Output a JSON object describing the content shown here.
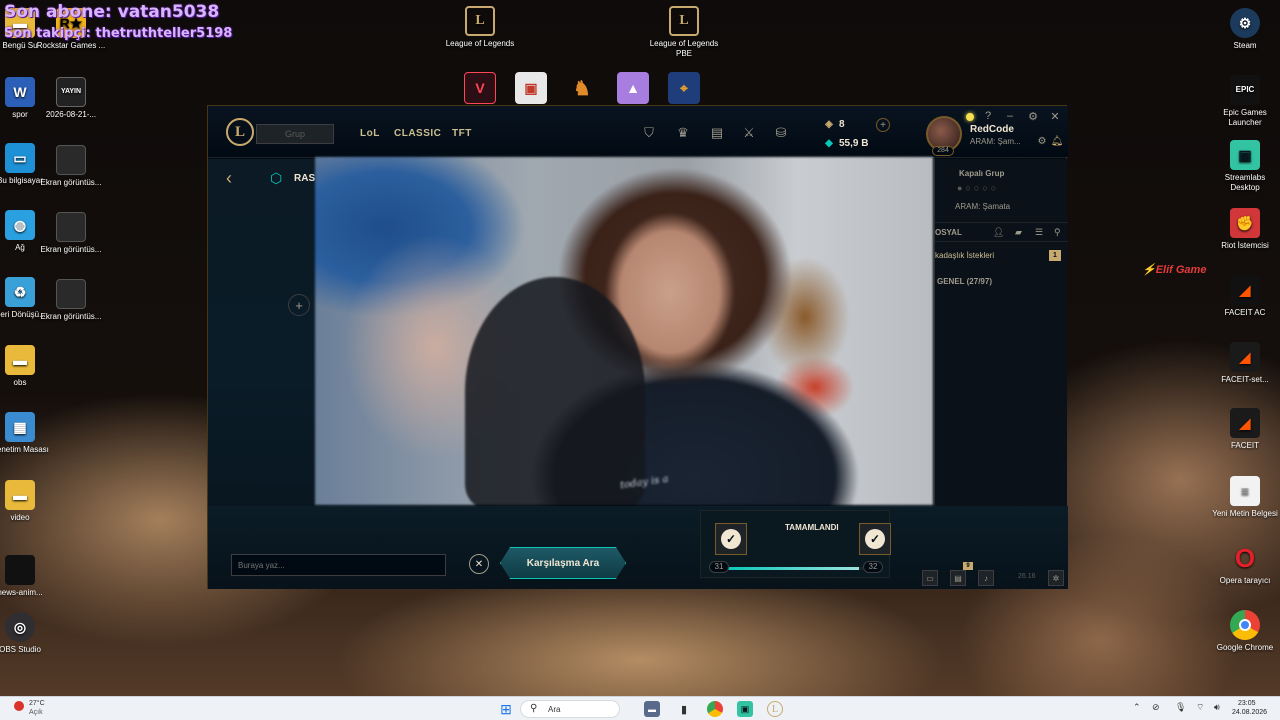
{
  "overlay": {
    "last_sub": "Son abone: vatan5038",
    "last_follow": "Son takipçi: thetruthteller5198"
  },
  "desktop_left": [
    {
      "label": "Bengü Su",
      "icon": "folder-icon",
      "color": "#e8b93a"
    },
    {
      "label": "Rockstar Games ...",
      "icon": "rockstar-icon",
      "color": "#f2b21a"
    },
    {
      "label": "spor",
      "icon": "word-doc-icon",
      "color": "#2b5fb8"
    },
    {
      "label": "2026-08-21-...",
      "icon": "image-file-icon",
      "color": "#222222"
    },
    {
      "label": "Bu bilgisayar",
      "icon": "computer-icon",
      "color": "#1e90d6"
    },
    {
      "label": "Ekran görüntüs...",
      "icon": "screenshot-icon",
      "color": "#2a2a2a"
    },
    {
      "label": "Ağ",
      "icon": "network-icon",
      "color": "#2aa0e0"
    },
    {
      "label": "Ekran görüntüs...",
      "icon": "screenshot-icon",
      "color": "#2a2a2a"
    },
    {
      "label": "Geri Dönüşü...",
      "icon": "recycle-bin-icon",
      "color": "#3aa0d8"
    },
    {
      "label": "Ekran görüntüs...",
      "icon": "screenshot-icon",
      "color": "#2a2a2a"
    },
    {
      "label": "obs",
      "icon": "folder-icon",
      "color": "#e8b93a"
    },
    {
      "label": "Denetim Masası",
      "icon": "control-panel-icon",
      "color": "#3a8bd0"
    },
    {
      "label": "video",
      "icon": "folder-icon",
      "color": "#e8b93a"
    },
    {
      "label": "news-anim...",
      "icon": "video-file-icon",
      "color": "#111111"
    },
    {
      "label": "OBS Studio",
      "icon": "obs-icon",
      "color": "#302e31"
    }
  ],
  "desktop_top": [
    {
      "label": "League of Legends",
      "icon": "lol-icon"
    },
    {
      "label": "League of Legends PBE",
      "icon": "lol-pbe-icon"
    }
  ],
  "desktop_right": [
    {
      "label": "Steam",
      "icon": "steam-icon",
      "color": "#1b3a5c"
    },
    {
      "label": "Epic Games Launcher",
      "icon": "epic-games-icon",
      "color": "#111111"
    },
    {
      "label": "Streamlabs Desktop",
      "icon": "streamlabs-icon",
      "color": "#31c3a2"
    },
    {
      "label": "Riot İstemcisi",
      "icon": "riot-icon",
      "color": "#d13639"
    },
    {
      "label": "FACEIT AC",
      "icon": "faceit-ac-icon",
      "color": "#ff5500"
    },
    {
      "label": "FACEIT-set...",
      "icon": "faceit-setup-icon",
      "color": "#ff5500"
    },
    {
      "label": "FACEIT",
      "icon": "faceit-icon",
      "color": "#ff5500"
    },
    {
      "label": "Yeni Metin Belgesi",
      "icon": "text-file-icon",
      "color": "#f2f2f2"
    },
    {
      "label": "Opera tarayıcı",
      "icon": "opera-icon",
      "color": "#e0202a"
    },
    {
      "label": "Google Chrome",
      "icon": "chrome-icon",
      "color": "#4285f4"
    }
  ],
  "client": {
    "play_label": "Grup",
    "nav_tabs": [
      "LoL",
      "CLASSIC",
      "TFT"
    ],
    "rp": "8",
    "be": "55,9 B",
    "summoner_name": "RedCode",
    "summoner_status": "ARAM: Şam...",
    "level": "284",
    "mode_title": "RAS",
    "group_title": "Kapalı Grup",
    "group_mode": "ARAM: Şamata",
    "social_label": "OSYAL",
    "friend_requests": "kadaşlık İstekleri",
    "friend_request_count": "1",
    "general_label": "GENEL (27/97)",
    "chat_placeholder": "Buraya yaz...",
    "find_match_label": "Karşılaşma Ara",
    "ready_title": "TAMAMLANDI",
    "progress_min": "31",
    "progress_max": "32",
    "progress_fraction": 0.97,
    "bottom_badge": "9",
    "bottom_clock": "26.16",
    "webcam_shirt_text": "today is a"
  },
  "watermark": "Elif Game",
  "taskbar": {
    "temp": "27°C",
    "weather": "Açık",
    "search": "Ara",
    "time": "23:05",
    "date": "24.08.2026"
  }
}
